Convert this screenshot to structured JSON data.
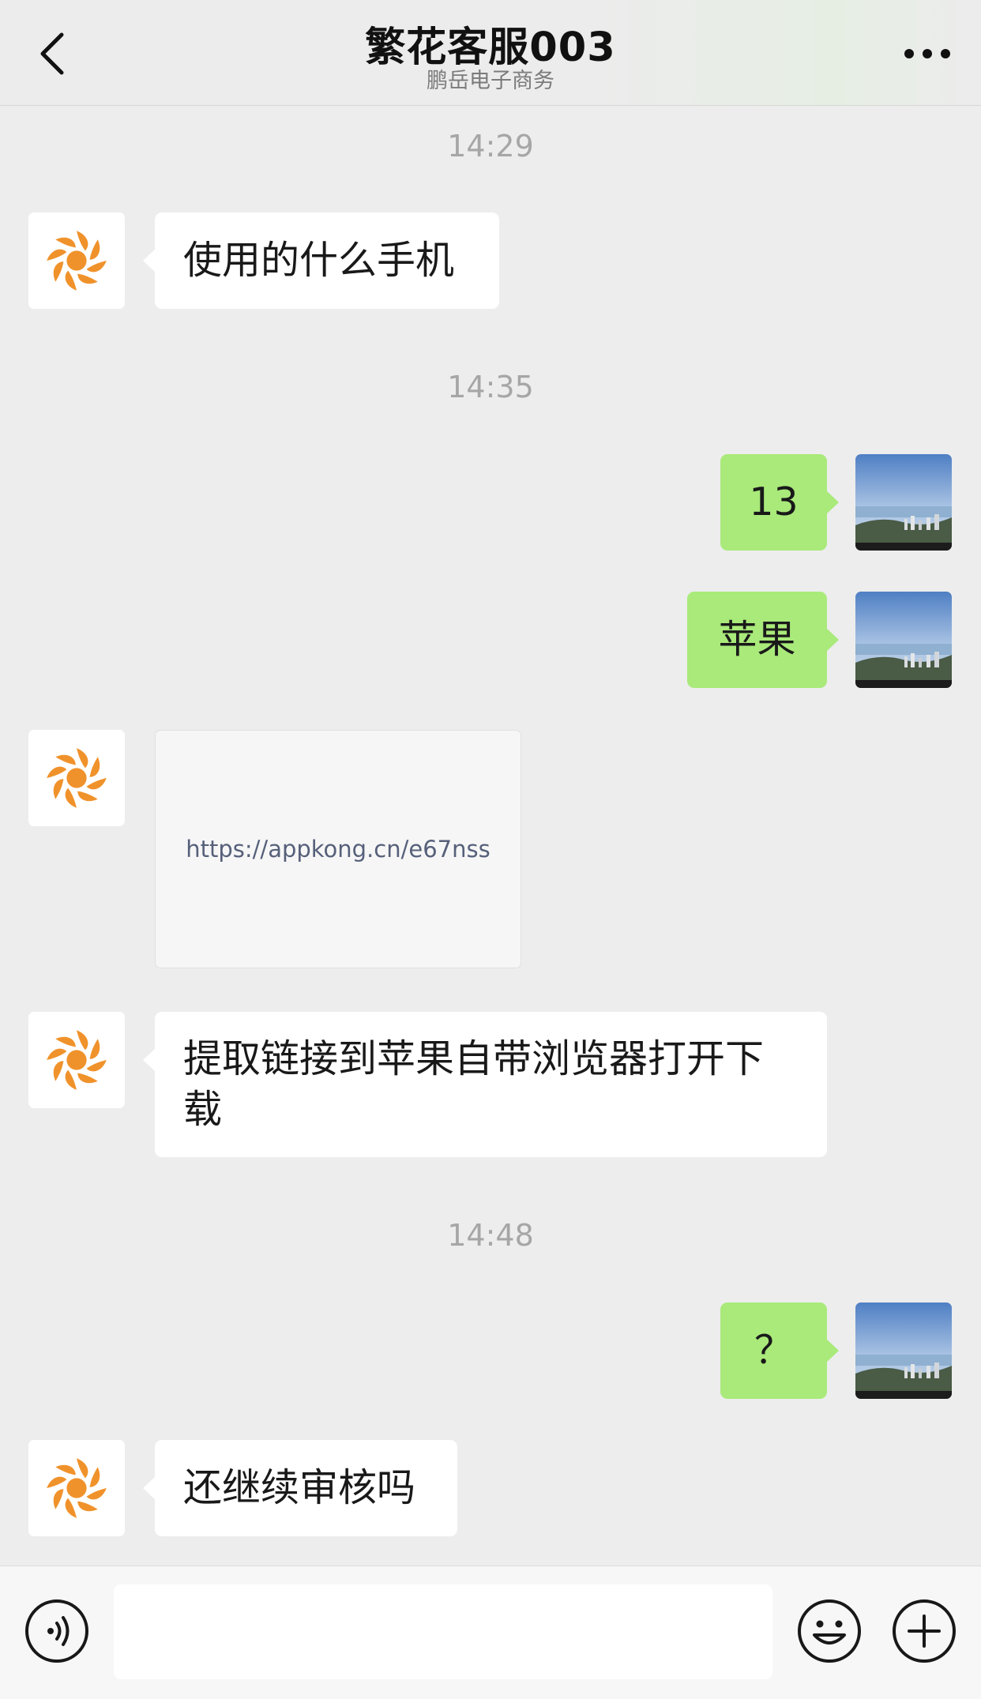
{
  "header": {
    "title": "繁花客服003",
    "subtitle": "鹏岳电子商务"
  },
  "timestamps": [
    "14:29",
    "14:35",
    "14:48"
  ],
  "messages": [
    {
      "sender": "service",
      "type": "text",
      "text": "使用的什么手机"
    },
    {
      "sender": "user",
      "type": "text",
      "text": "13"
    },
    {
      "sender": "user",
      "type": "text",
      "text": "苹果"
    },
    {
      "sender": "service",
      "type": "link",
      "text": "https://appkong.cn/e67nss"
    },
    {
      "sender": "service",
      "type": "text",
      "text": "提取链接到苹果自带浏览器打开下载"
    },
    {
      "sender": "user",
      "type": "text",
      "text": "？"
    },
    {
      "sender": "service",
      "type": "text",
      "text": "还继续审核吗"
    }
  ],
  "toolbar": {
    "input_value": "",
    "icons": [
      "voice-icon",
      "emoji-icon",
      "plus-icon"
    ]
  },
  "colors": {
    "background": "#ededed",
    "self_bubble": "#a9ea7a",
    "other_bubble": "#ffffff",
    "service_logo": "#f0922b"
  }
}
